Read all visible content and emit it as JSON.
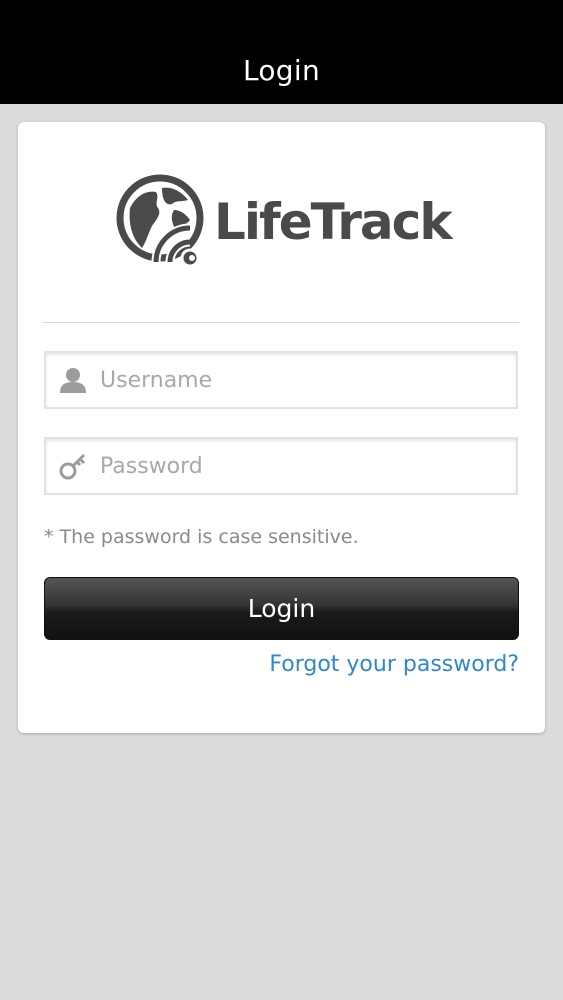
{
  "header": {
    "title": "Login"
  },
  "brand": {
    "name": "LifeTrack",
    "logo_icon": "globe-signal-icon",
    "color": "#4a4a4a"
  },
  "form": {
    "username": {
      "icon": "user-icon",
      "value": "",
      "placeholder": "Username"
    },
    "password": {
      "icon": "key-icon",
      "value": "",
      "placeholder": "Password"
    },
    "hint": "* The password is case sensitive.",
    "submit_label": "Login",
    "forgot_link": "Forgot your password?"
  },
  "colors": {
    "header_bg": "#000000",
    "page_bg": "#dcdcdc",
    "link": "#2f88c9"
  }
}
